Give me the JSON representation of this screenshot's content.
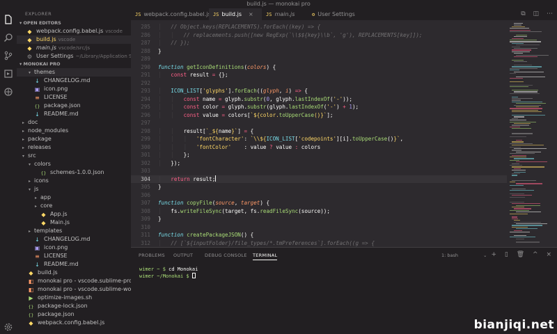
{
  "window": {
    "title": "build.js — monokai pro"
  },
  "sidebar": {
    "explorer_title": "EXPLORER",
    "open_editors_label": "▾ OPEN EDITORS",
    "open_editors": [
      {
        "icon": "js",
        "name": "webpack.config.babel.js",
        "sub": "vscode"
      },
      {
        "icon": "js",
        "name": "build.js",
        "sub": "vscode"
      },
      {
        "icon": "js",
        "name": "main.js",
        "sub": "vscode/src/js"
      },
      {
        "icon": "gear",
        "name": "User Settings",
        "sub": "~/Library/Application Su..."
      }
    ],
    "project_label": "▾ MONOKAI PRO",
    "tree": [
      {
        "label": "themes",
        "type": "folder-open",
        "depth": 1
      },
      {
        "label": "CHANGELOG.md",
        "type": "md",
        "depth": 1
      },
      {
        "label": "icon.png",
        "type": "png",
        "depth": 1
      },
      {
        "label": "LICENSE",
        "type": "lic",
        "depth": 1
      },
      {
        "label": "package.json",
        "type": "json",
        "depth": 1
      },
      {
        "label": "README.md",
        "type": "md",
        "depth": 1
      },
      {
        "label": "doc",
        "type": "folder",
        "depth": 0
      },
      {
        "label": "node_modules",
        "type": "folder",
        "depth": 0
      },
      {
        "label": "package",
        "type": "folder",
        "depth": 0
      },
      {
        "label": "releases",
        "type": "folder",
        "depth": 0
      },
      {
        "label": "src",
        "type": "folder-open",
        "depth": 0
      },
      {
        "label": "colors",
        "type": "folder-open",
        "depth": 1
      },
      {
        "label": "schemes-1.0.0.json",
        "type": "json",
        "depth": 2
      },
      {
        "label": "icons",
        "type": "folder",
        "depth": 1
      },
      {
        "label": "js",
        "type": "folder-open",
        "depth": 1
      },
      {
        "label": "app",
        "type": "folder",
        "depth": 2
      },
      {
        "label": "core",
        "type": "folder",
        "depth": 2
      },
      {
        "label": "App.js",
        "type": "js",
        "depth": 2
      },
      {
        "label": "Main.js",
        "type": "js",
        "depth": 2
      },
      {
        "label": "templates",
        "type": "folder",
        "depth": 1
      },
      {
        "label": "CHANGELOG.md",
        "type": "md",
        "depth": 1
      },
      {
        "label": "icon.png",
        "type": "png",
        "depth": 1
      },
      {
        "label": "LICENSE",
        "type": "lic",
        "depth": 1
      },
      {
        "label": "README.md",
        "type": "md",
        "depth": 1
      },
      {
        "label": "build.js",
        "type": "js",
        "depth": 0
      },
      {
        "label": "monokai pro - vscode.sublime-project",
        "type": "sub",
        "depth": 0
      },
      {
        "label": "monokai pro - vscode.sublime-worksp...",
        "type": "sub",
        "depth": 0
      },
      {
        "label": "optimize-images.sh",
        "type": "sh",
        "depth": 0
      },
      {
        "label": "package-lock.json",
        "type": "json",
        "depth": 0
      },
      {
        "label": "package.json",
        "type": "json",
        "depth": 0
      },
      {
        "label": "webpack.config.babel.js",
        "type": "js",
        "depth": 0
      }
    ]
  },
  "tabs": [
    {
      "icon": "JS",
      "label": "webpack.config.babel.js"
    },
    {
      "icon": "JS",
      "label": "build.js",
      "close": "×"
    },
    {
      "icon": "JS",
      "label": "main.js"
    },
    {
      "icon": "⚙",
      "label": "User Settings"
    }
  ],
  "editor": {
    "lines": [
      {
        "n": "285",
        "html": "<span class='guide'>│   </span><span class='cm'>// Object.keys(REPLACEMENTS).forEach((key) =&gt; {</span>"
      },
      {
        "n": "286",
        "html": "<span class='guide'>│   │   </span><span class='cm'>// replacements.push([new RegExp(`\\\\$${key}\\\\b`, 'g'), REPLACEMENTS[key]]);</span>"
      },
      {
        "n": "287",
        "html": "<span class='guide'>│   </span><span class='cm'>// });</span>"
      },
      {
        "n": "288",
        "html": "}"
      },
      {
        "n": "289",
        "html": ""
      },
      {
        "n": "290",
        "html": "<span class='fnkw'>function</span> <span class='fn'>getIconDefinitions</span>(<span class='par'>colors</span>) {"
      },
      {
        "n": "291",
        "html": "<span class='guide'>│   </span><span class='kw'>const</span> result <span class='kw'>=</span> {};"
      },
      {
        "n": "292",
        "html": ""
      },
      {
        "n": "293",
        "html": "<span class='guide'>│   </span><span class='cst'>ICON_LIST</span>[<span class='str'>'glyphs'</span>].<span class='fn'>forEach</span>((<span class='par'>glyph</span>, <span class='par'>i</span>) <span class='kw'>=&gt;</span> {"
      },
      {
        "n": "294",
        "html": "<span class='guide'>│   │   </span><span class='kw'>const</span> name <span class='kw'>=</span> glyph.<span class='fn'>substr</span>(<span class='num'>0</span>, glyph.<span class='fn'>lastIndexOf</span>(<span class='str'>'-'</span>));"
      },
      {
        "n": "295",
        "html": "<span class='guide'>│   │   </span><span class='kw'>const</span> color <span class='kw'>=</span> glyph.<span class='fn'>substr</span>(glyph.<span class='fn'>lastIndexOf</span>(<span class='str'>'-'</span>) <span class='kw'>+</span> <span class='num'>1</span>);"
      },
      {
        "n": "296",
        "html": "<span class='guide'>│   │   </span><span class='kw'>const</span> value <span class='kw'>=</span> colors[<span class='str'>`${color.</span><span class='fn'>toUpperCase</span><span class='str'>()}`</span>];"
      },
      {
        "n": "297",
        "html": ""
      },
      {
        "n": "298",
        "html": "<span class='guide'>│   │   </span>result[<span class='str'>`_${</span>name<span class='str'>}`</span>] <span class='kw'>=</span> {"
      },
      {
        "n": "299",
        "html": "<span class='guide'>│   │   │   </span><span class='str'>'fontCharacter'</span>: <span class='str'>`\\\\${</span><span class='cst'>ICON_LIST</span>[<span class='str'>'codepoints'</span>][i].<span class='fn'>toUpperCase</span>()<span class='str'>}`</span>,"
      },
      {
        "n": "300",
        "html": "<span class='guide'>│   │   │   </span><span class='str'>'fontColor'</span>    : value <span class='kw'>?</span> value <span class='kw'>:</span> colors"
      },
      {
        "n": "301",
        "html": "<span class='guide'>│   │   </span>};"
      },
      {
        "n": "302",
        "html": "<span class='guide'>│   </span>});"
      },
      {
        "n": "303",
        "html": ""
      },
      {
        "n": "304",
        "html": "<span class='guide'>│   </span><span class='kw'>return</span> result;<span class='cursor'></span>",
        "current": true
      },
      {
        "n": "305",
        "html": "}"
      },
      {
        "n": "306",
        "html": ""
      },
      {
        "n": "307",
        "html": "<span class='fnkw'>function</span> <span class='fn'>copyFile</span>(<span class='par'>source</span>, <span class='par'>target</span>) {"
      },
      {
        "n": "308",
        "html": "<span class='guide'>│   </span>fs.<span class='fn'>writeFileSync</span>(target, fs.<span class='fn'>readFileSync</span>(source));"
      },
      {
        "n": "309",
        "html": "}"
      },
      {
        "n": "310",
        "html": ""
      },
      {
        "n": "311",
        "html": "<span class='fnkw'>function</span> <span class='fn'>createPackageJSON</span>() {"
      },
      {
        "n": "312",
        "html": "<span class='guide'>│   </span><span class='cm'>// [`${inputFolder}/file_types/*.tmPreferences`].forEach((g =&gt; {</span>"
      }
    ]
  },
  "panel": {
    "tabs": [
      "PROBLEMS",
      "OUTPUT",
      "DEBUG CONSOLE",
      "TERMINAL"
    ],
    "active_tab": "TERMINAL",
    "terminal_select": "1: bash",
    "select_chevron": "⌄",
    "actions": [
      "+",
      "▯",
      "🗑",
      "^",
      "×"
    ],
    "terminal_lines": [
      {
        "prompt": "wimer ~ $ ",
        "text": "cd Monokai"
      },
      {
        "prompt": "wimer ~/Monokai $ ",
        "text": ""
      }
    ]
  },
  "tab_actions": [
    "⧉",
    "◫",
    "⋯"
  ],
  "watermark": "bianjiqi.net",
  "colors": {
    "accent": "#ffd866",
    "background": "#2d2a2e",
    "sidebar": "#221f22"
  }
}
